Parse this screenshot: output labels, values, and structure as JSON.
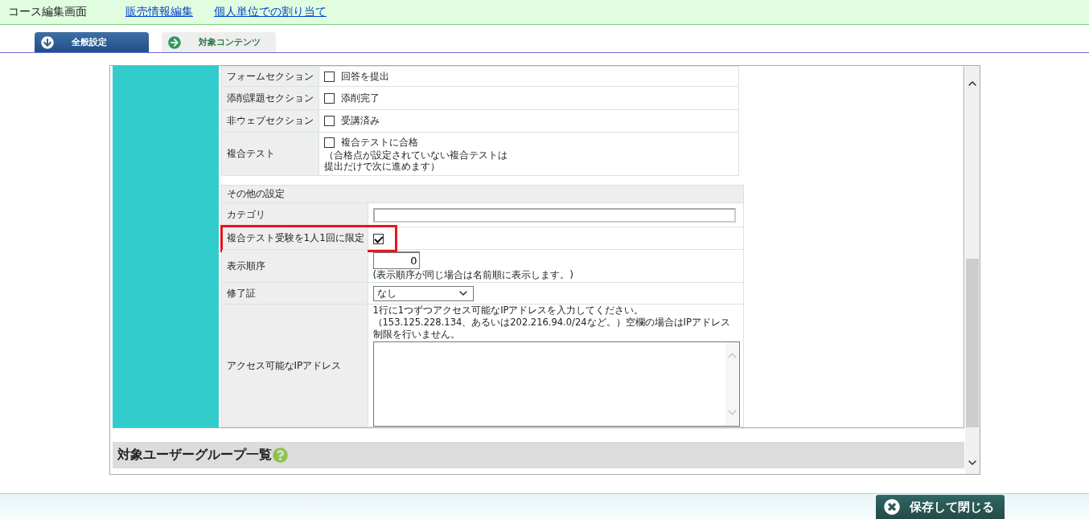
{
  "header": {
    "title": "コース編集画面",
    "links": [
      "販売情報編集",
      "個人単位での割り当て"
    ]
  },
  "tabs": [
    {
      "label": "全般設定",
      "selected": true
    },
    {
      "label": "対象コンテンツ",
      "selected": false
    }
  ],
  "completion_table": {
    "rows": [
      {
        "label": "フォームセクション",
        "option": "回答を提出",
        "checked": false
      },
      {
        "label": "添削課題セクション",
        "option": "添削完了",
        "checked": false
      },
      {
        "label": "非ウェブセクション",
        "option": "受講済み",
        "checked": false
      },
      {
        "label": "複合テスト",
        "option": "複合テストに合格",
        "checked": false,
        "note_lines": [
          "（合格点が設定されていない複合テストは",
          "提出だけで次に進めます）"
        ]
      }
    ]
  },
  "other_settings": {
    "title": "その他の設定",
    "rows": [
      {
        "kind": "text",
        "label": "カテゴリ"
      },
      {
        "kind": "checkbox",
        "label": "複合テスト受験を1人1回に限定",
        "checked": true,
        "highlighted": true
      },
      {
        "kind": "number",
        "label": "表示順序",
        "value": "0",
        "note": "(表示順序が同じ場合は名前順に表示します。)"
      },
      {
        "kind": "select",
        "label": "修了証",
        "value": "なし"
      },
      {
        "kind": "textarea",
        "label": "アクセス可能なIPアドレス",
        "description": "1行に1つずつアクセス可能なIPアドレスを入力してください。（153.125.228.134、あるいは202.216.94.0/24など。）空欄の場合はIPアドレス制限を行いません。"
      }
    ]
  },
  "group_section": {
    "title": "対象ユーザーグループ一覧"
  },
  "footer": {
    "save_button": "保存して閉じる"
  }
}
